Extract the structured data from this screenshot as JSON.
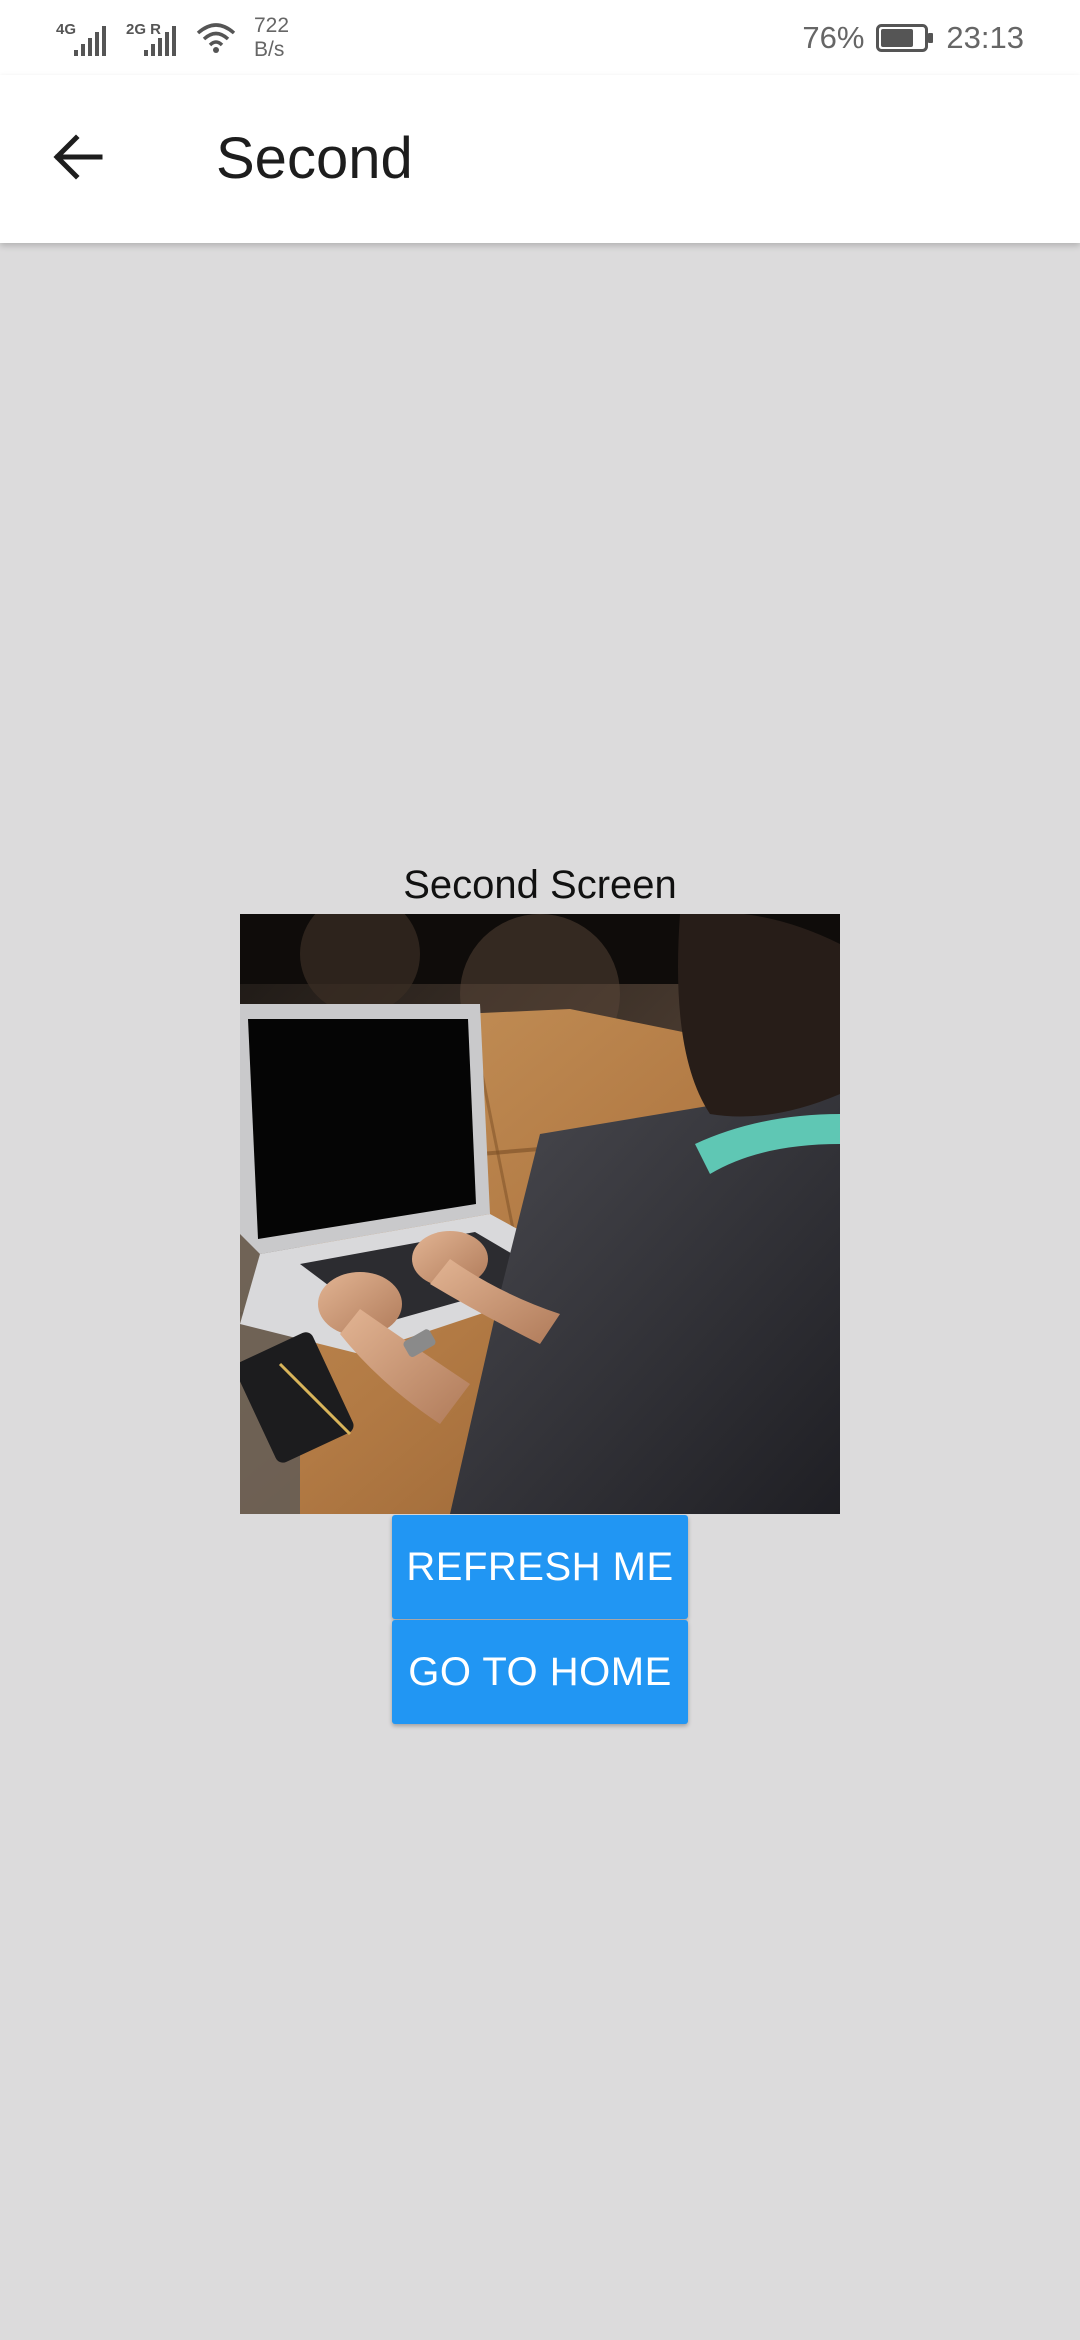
{
  "status_bar": {
    "net1": "4G",
    "net2": "2G R",
    "speed_value": "722",
    "speed_unit": "B/s",
    "battery_percent": "76%",
    "battery_level": 0.76,
    "time": "23:13",
    "icons": [
      "signal-icon",
      "signal-icon",
      "wifi-icon",
      "battery-icon"
    ]
  },
  "app_bar": {
    "title": "Second",
    "back_icon": "arrow-left-icon"
  },
  "main": {
    "label": "Second Screen",
    "image_description": "photo",
    "buttons": {
      "refresh": "REFRESH ME",
      "home": "GO TO HOME"
    }
  },
  "colors": {
    "background": "#dcdbdc",
    "app_bar": "#ffffff",
    "button": "#2196f3",
    "button_text": "#ffffff"
  }
}
